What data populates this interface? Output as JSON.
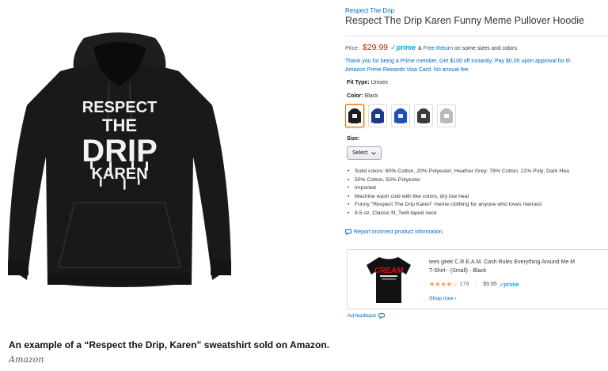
{
  "product": {
    "brand": "Respect The Drip",
    "title": "Respect The Drip Karen Funny Meme Pullover Hoodie",
    "hoodie_print_lines": [
      "RESPECT",
      "THE",
      "DRIP",
      "KAREN"
    ],
    "price_label": "Price:",
    "price": "$29.99",
    "prime_check": "✓",
    "prime": "prime",
    "free_return_prefix": "& ",
    "free_return_link": "Free Return",
    "free_return_suffix": " on some sizes and colors",
    "promo_line1": "Thank you for being a Prime member. Get $100 off instantly: Pay $0.00 upon approval for th",
    "promo_line2": "Amazon Prime Rewards Visa Card. No annual fee.",
    "fit_label": "Fit Type:",
    "fit_value": "Unisex",
    "color_label": "Color:",
    "color_value": "Black",
    "swatch_colors": [
      "#1b1b1b",
      "#1d3a8a",
      "#1d52b8",
      "#3a3a3a",
      "#b9b9b9"
    ],
    "selected_swatch_color": "#e77600",
    "size_label": "Size:",
    "size_select": "Select",
    "bullets": [
      "Solid colors: 80% Cotton, 20% Polyester; Heather Grey: 78% Cotton, 22% Poly; Dark Hea",
      "50% Cotton, 50% Polyester",
      "Imported",
      "Machine wash cold with like colors, dry low heat",
      "Funny \"Respect The Drip Karen\" meme clothing for anyone who loves memes!",
      "8.5 oz, Classic fit, Twill-taped neck"
    ],
    "report": "Report incorrect product information."
  },
  "ad": {
    "title_line1": "tees geek C.R.E.A.M. Cash Rules Everything Around Me M",
    "title_line2": "T-Shirt - (Small) - Black",
    "shirt_print": "CREAM",
    "stars": "★★★★☆",
    "rating_count": "179",
    "divider": "|",
    "price": "$9.95",
    "prime": "✓prime",
    "shop_now": "Shop now ›",
    "feedback": "Ad feedback"
  },
  "caption": {
    "text": "An example of a “Respect the Drip, Karen” sweatshirt sold on Amazon.",
    "credit": "Amazon"
  },
  "colors": {
    "link": "#0066c0",
    "price": "#b12704",
    "prime": "#00a8e1",
    "star": "#f4a41c"
  }
}
